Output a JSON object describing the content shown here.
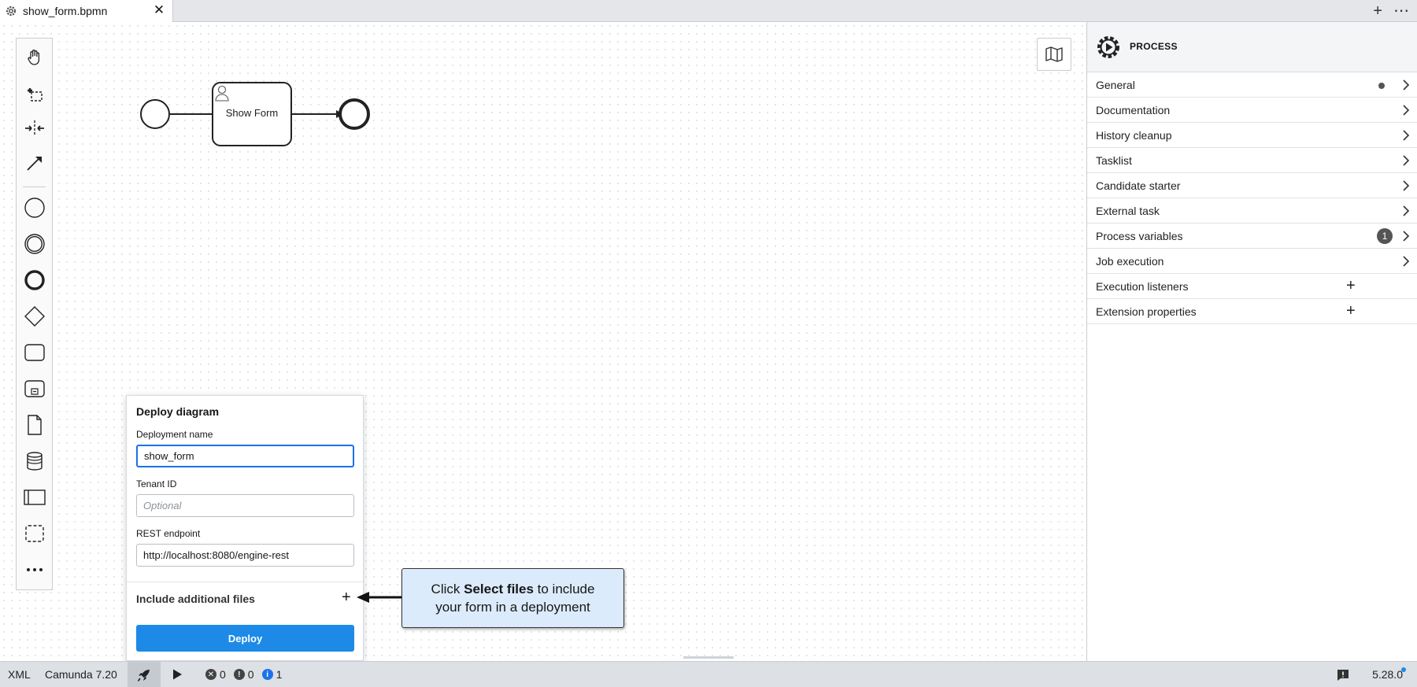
{
  "tabs": [
    {
      "label": "show_form.bpmn"
    }
  ],
  "diagram": {
    "task_label": "Show Form"
  },
  "deploy_dialog": {
    "title": "Deploy diagram",
    "deployment_name_label": "Deployment name",
    "deployment_name_value": "show_form",
    "tenant_id_label": "Tenant ID",
    "tenant_id_placeholder": "Optional",
    "rest_endpoint_label": "REST endpoint",
    "rest_endpoint_value": "http://localhost:8080/engine-rest",
    "include_files_label": "Include additional files",
    "deploy_button": "Deploy"
  },
  "callout": {
    "prefix": "Click ",
    "bold": "Select files",
    "suffix": " to include your form in a deployment"
  },
  "properties": {
    "element_type": "PROCESS",
    "groups": [
      {
        "label": "General",
        "indicator": "dot"
      },
      {
        "label": "Documentation"
      },
      {
        "label": "History cleanup"
      },
      {
        "label": "Tasklist"
      },
      {
        "label": "Candidate starter"
      },
      {
        "label": "External task"
      },
      {
        "label": "Process variables",
        "count": "1"
      },
      {
        "label": "Job execution"
      },
      {
        "label": "Execution listeners",
        "action": "add"
      },
      {
        "label": "Extension properties",
        "action": "add"
      }
    ]
  },
  "status_bar": {
    "format": "XML",
    "engine": "Camunda 7.20",
    "errors": "0",
    "warnings": "0",
    "infos": "1",
    "version": "5.28.0"
  },
  "colors": {
    "accent": "#1c8ae6",
    "callout_bg": "#dcebfb",
    "info_badge": "#1a73e8"
  }
}
